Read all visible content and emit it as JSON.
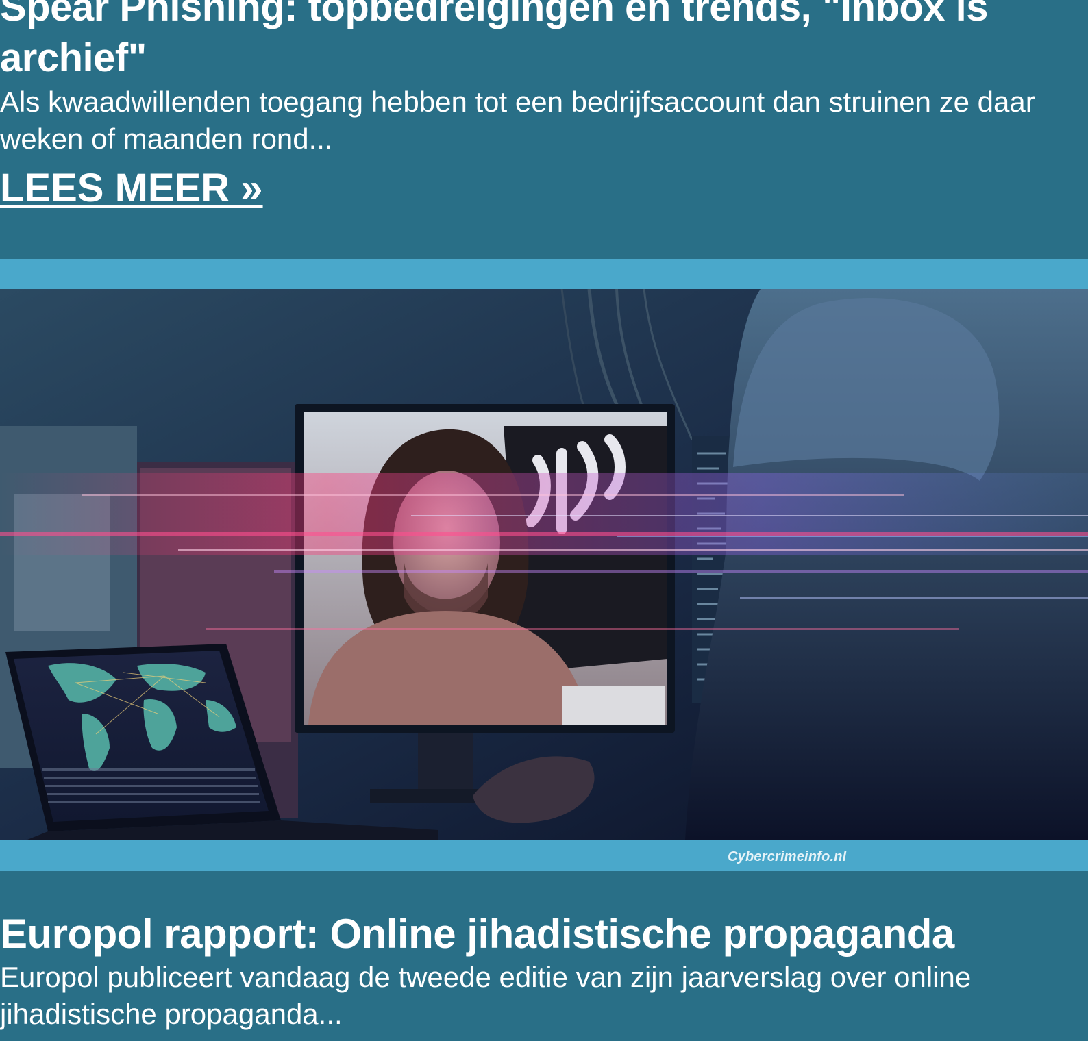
{
  "articles": [
    {
      "title": "Spear Phishing: topbedreigingen en trends, \"Inbox is archief\"",
      "excerpt": "Als kwaadwillenden toegang hebben tot een bedrijfsaccount dan struinen ze daar weken of maanden rond...",
      "read_more": "LEES MEER »"
    },
    {
      "title": "Europol rapport: Online jihadistische propaganda",
      "excerpt": "Europol publiceert vandaag de tweede editie van zijn jaarverslag over online jihadistische propaganda..."
    }
  ],
  "banner": {
    "watermark": "Cybercrimeinfo.nl",
    "flag_text": "لا إله"
  },
  "colors": {
    "page_background": "#296f87",
    "banner_frame": "#4aa8cb",
    "text": "#ffffff"
  }
}
